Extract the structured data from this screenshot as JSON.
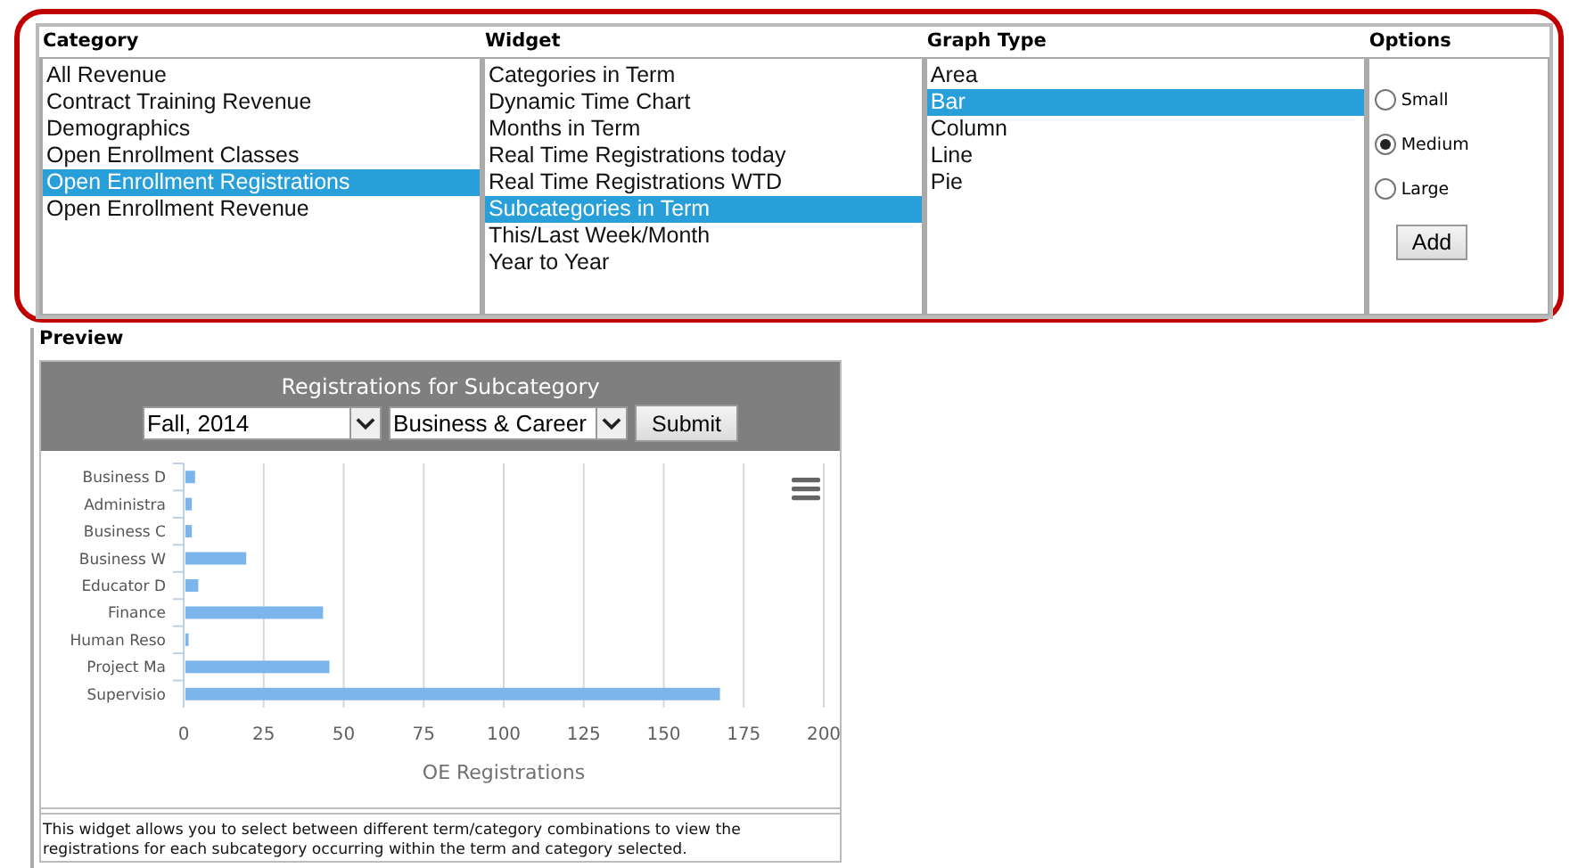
{
  "columns": [
    {
      "heading": "Category",
      "items": [
        {
          "label": "All Revenue",
          "selected": false
        },
        {
          "label": "Contract Training Revenue",
          "selected": false
        },
        {
          "label": "Demographics",
          "selected": false
        },
        {
          "label": "Open Enrollment Classes",
          "selected": false
        },
        {
          "label": "Open Enrollment Registrations",
          "selected": true
        },
        {
          "label": "Open Enrollment Revenue",
          "selected": false
        }
      ]
    },
    {
      "heading": "Widget",
      "items": [
        {
          "label": "Categories in Term",
          "selected": false
        },
        {
          "label": "Dynamic Time Chart",
          "selected": false
        },
        {
          "label": "Months in Term",
          "selected": false
        },
        {
          "label": "Real Time Registrations today",
          "selected": false
        },
        {
          "label": "Real Time Registrations WTD",
          "selected": false
        },
        {
          "label": "Subcategories in Term",
          "selected": true
        },
        {
          "label": "This/Last Week/Month",
          "selected": false
        },
        {
          "label": "Year to Year",
          "selected": false
        }
      ]
    },
    {
      "heading": "Graph Type",
      "items": [
        {
          "label": "Area",
          "selected": false
        },
        {
          "label": "Bar",
          "selected": true
        },
        {
          "label": "Column",
          "selected": false
        },
        {
          "label": "Line",
          "selected": false
        },
        {
          "label": "Pie",
          "selected": false
        }
      ]
    }
  ],
  "options": {
    "heading": "Options",
    "sizes": [
      {
        "label": "Small",
        "selected": false
      },
      {
        "label": "Medium",
        "selected": true
      },
      {
        "label": "Large",
        "selected": false
      }
    ],
    "add_button": "Add"
  },
  "preview": {
    "label": "Preview",
    "widget_title": "Registrations for Subcategory",
    "term": "Fall, 2014",
    "category": "Business & Career",
    "submit": "Submit",
    "chart_data": {
      "type": "bar",
      "orientation": "horizontal",
      "xlabel": "OE Registrations",
      "categories": [
        "Business D",
        "Administra",
        "Business C",
        "Business W",
        "Educator D",
        "Finance",
        "Human Reso",
        "Project Ma",
        "Supervisio"
      ],
      "series": [
        {
          "color": "#7cb5ec",
          "values": [
            3,
            2,
            2,
            19,
            4,
            43,
            1,
            45,
            167
          ]
        }
      ],
      "grid": true,
      "xlim": [
        0,
        200
      ],
      "xticks": [
        0,
        25,
        50,
        75,
        100,
        125,
        150,
        175,
        200
      ]
    },
    "description": "This widget allows you to select between different term/category combinations to view the registrations for each subcategory occurring within the term and category selected."
  }
}
